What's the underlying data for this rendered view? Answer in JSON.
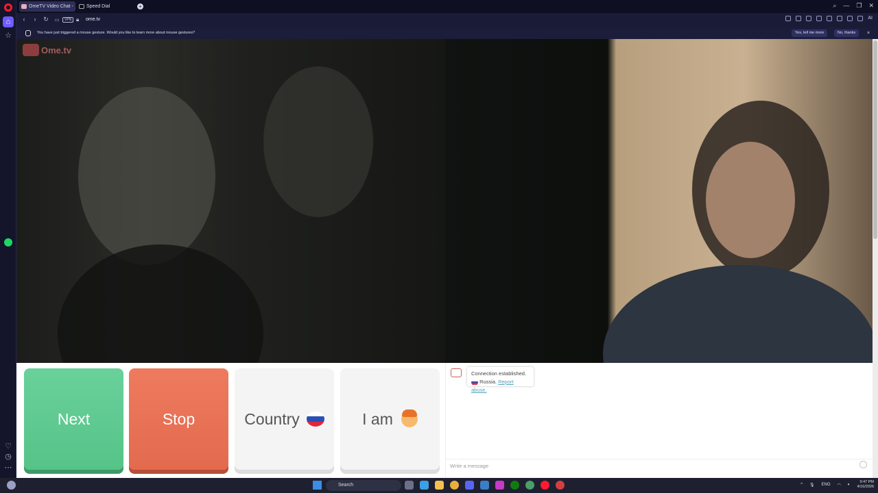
{
  "browser": {
    "tabs": [
      {
        "label": "OmeTV Video Chat -",
        "active": true
      },
      {
        "label": "Speed Dial",
        "active": false
      }
    ],
    "new_tab": "+",
    "url": "ome.tv",
    "vpn_label": "VPN",
    "ai_label": "AI",
    "window_controls": [
      "⌕",
      "—",
      "❐",
      "✕"
    ]
  },
  "notification": {
    "text": "You have just triggered a mouse gesture. Would you like to learn more about mouse gestures?",
    "yes_label": "Yes, tell me more",
    "no_label": "No, thanks",
    "close": "×"
  },
  "site": {
    "logo_text": "Ome.tv"
  },
  "controls": {
    "next_label": "Next",
    "stop_label": "Stop",
    "country_label": "Country",
    "iam_label": "I am",
    "country_flag_colors": [
      "#ffffff",
      "#2b4fb5",
      "#e0283a"
    ]
  },
  "chat": {
    "status": "Connection established.",
    "country": "Russia.",
    "report_link": "Report abuse.",
    "input_placeholder": "Write a message"
  },
  "taskbar": {
    "search_label": "Search",
    "language": "ENG",
    "time": "9:47 PM",
    "date": "4/16/2026"
  },
  "colors": {
    "next": "#5cc98e",
    "stop": "#e8704f",
    "opera_red": "#ff1b2d",
    "accent": "#6e5cff"
  }
}
